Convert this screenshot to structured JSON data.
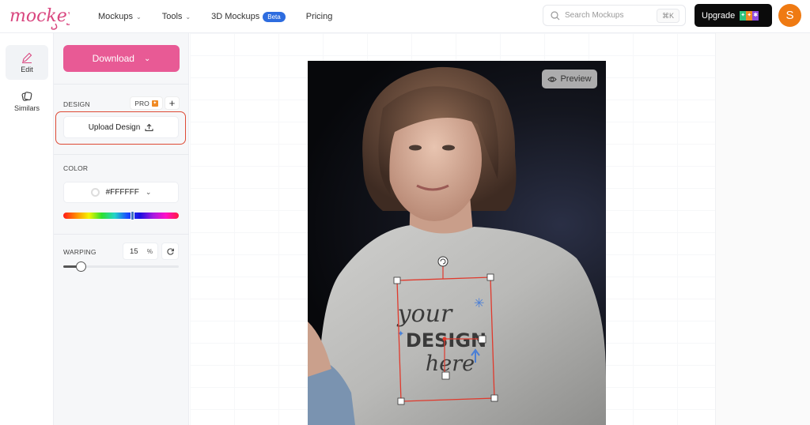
{
  "header": {
    "logo_text": "mockey",
    "nav": [
      {
        "label": "Mockups",
        "has_dropdown": true
      },
      {
        "label": "Tools",
        "has_dropdown": true
      },
      {
        "label": "3D Mockups",
        "badge": "Beta",
        "has_dropdown": false
      },
      {
        "label": "Pricing",
        "has_dropdown": false
      }
    ],
    "search": {
      "placeholder": "Search Mockups",
      "shortcut": "⌘K"
    },
    "upgrade_label": "Upgrade",
    "avatar_initial": "S"
  },
  "rail": {
    "items": [
      {
        "label": "Edit",
        "icon": "pencil-icon",
        "active": true
      },
      {
        "label": "Similars",
        "icon": "similars-icon",
        "active": false
      }
    ]
  },
  "panel": {
    "download_label": "Download",
    "design": {
      "label": "DESIGN",
      "pro_label": "PRO",
      "add_label": "+",
      "upload_label": "Upload Design"
    },
    "color": {
      "label": "COLOR",
      "value": "#FFFFFF",
      "hue_position": 0.6
    },
    "warping": {
      "label": "WARPING",
      "value": "15",
      "unit": "%",
      "slider_fraction": 0.15
    }
  },
  "canvas": {
    "preview_label": "Preview",
    "design_placeholder": {
      "line1": "your",
      "line2": "DESIGN",
      "line3": "here"
    }
  },
  "colors": {
    "brand_pink": "#e85a95",
    "highlight_red": "#de4a35",
    "avatar_orange": "#ef7a12",
    "beta_blue": "#2d6cdf"
  }
}
